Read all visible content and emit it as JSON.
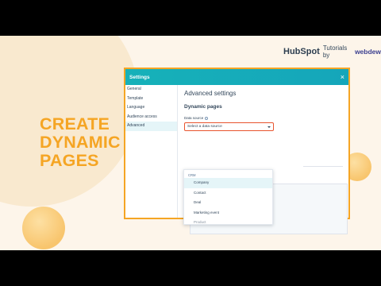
{
  "headline": [
    "CREATE",
    "DYNAMIC",
    "PAGES"
  ],
  "brand": {
    "hubspot": "HubSpot",
    "tutorials": "Tutorials by",
    "webdew": "webdew"
  },
  "modal": {
    "title": "Settings",
    "close_icon": "×",
    "sidebar": [
      "General",
      "Template",
      "Language",
      "Audience access",
      "Advanced"
    ],
    "active_sidebar_index": 4,
    "heading": "Advanced settings",
    "subheading": "Dynamic pages",
    "data_source_label": "Data source",
    "data_source_placeholder": "Select a data source"
  },
  "dropdown": {
    "group": "CRM",
    "options": [
      "Company",
      "Contact",
      "Deal",
      "Marketing event",
      "Product"
    ],
    "hover_index": 0
  },
  "colors": {
    "accent": "#f5a524",
    "header": "#16b1b9",
    "select_border": "#e8542e"
  }
}
